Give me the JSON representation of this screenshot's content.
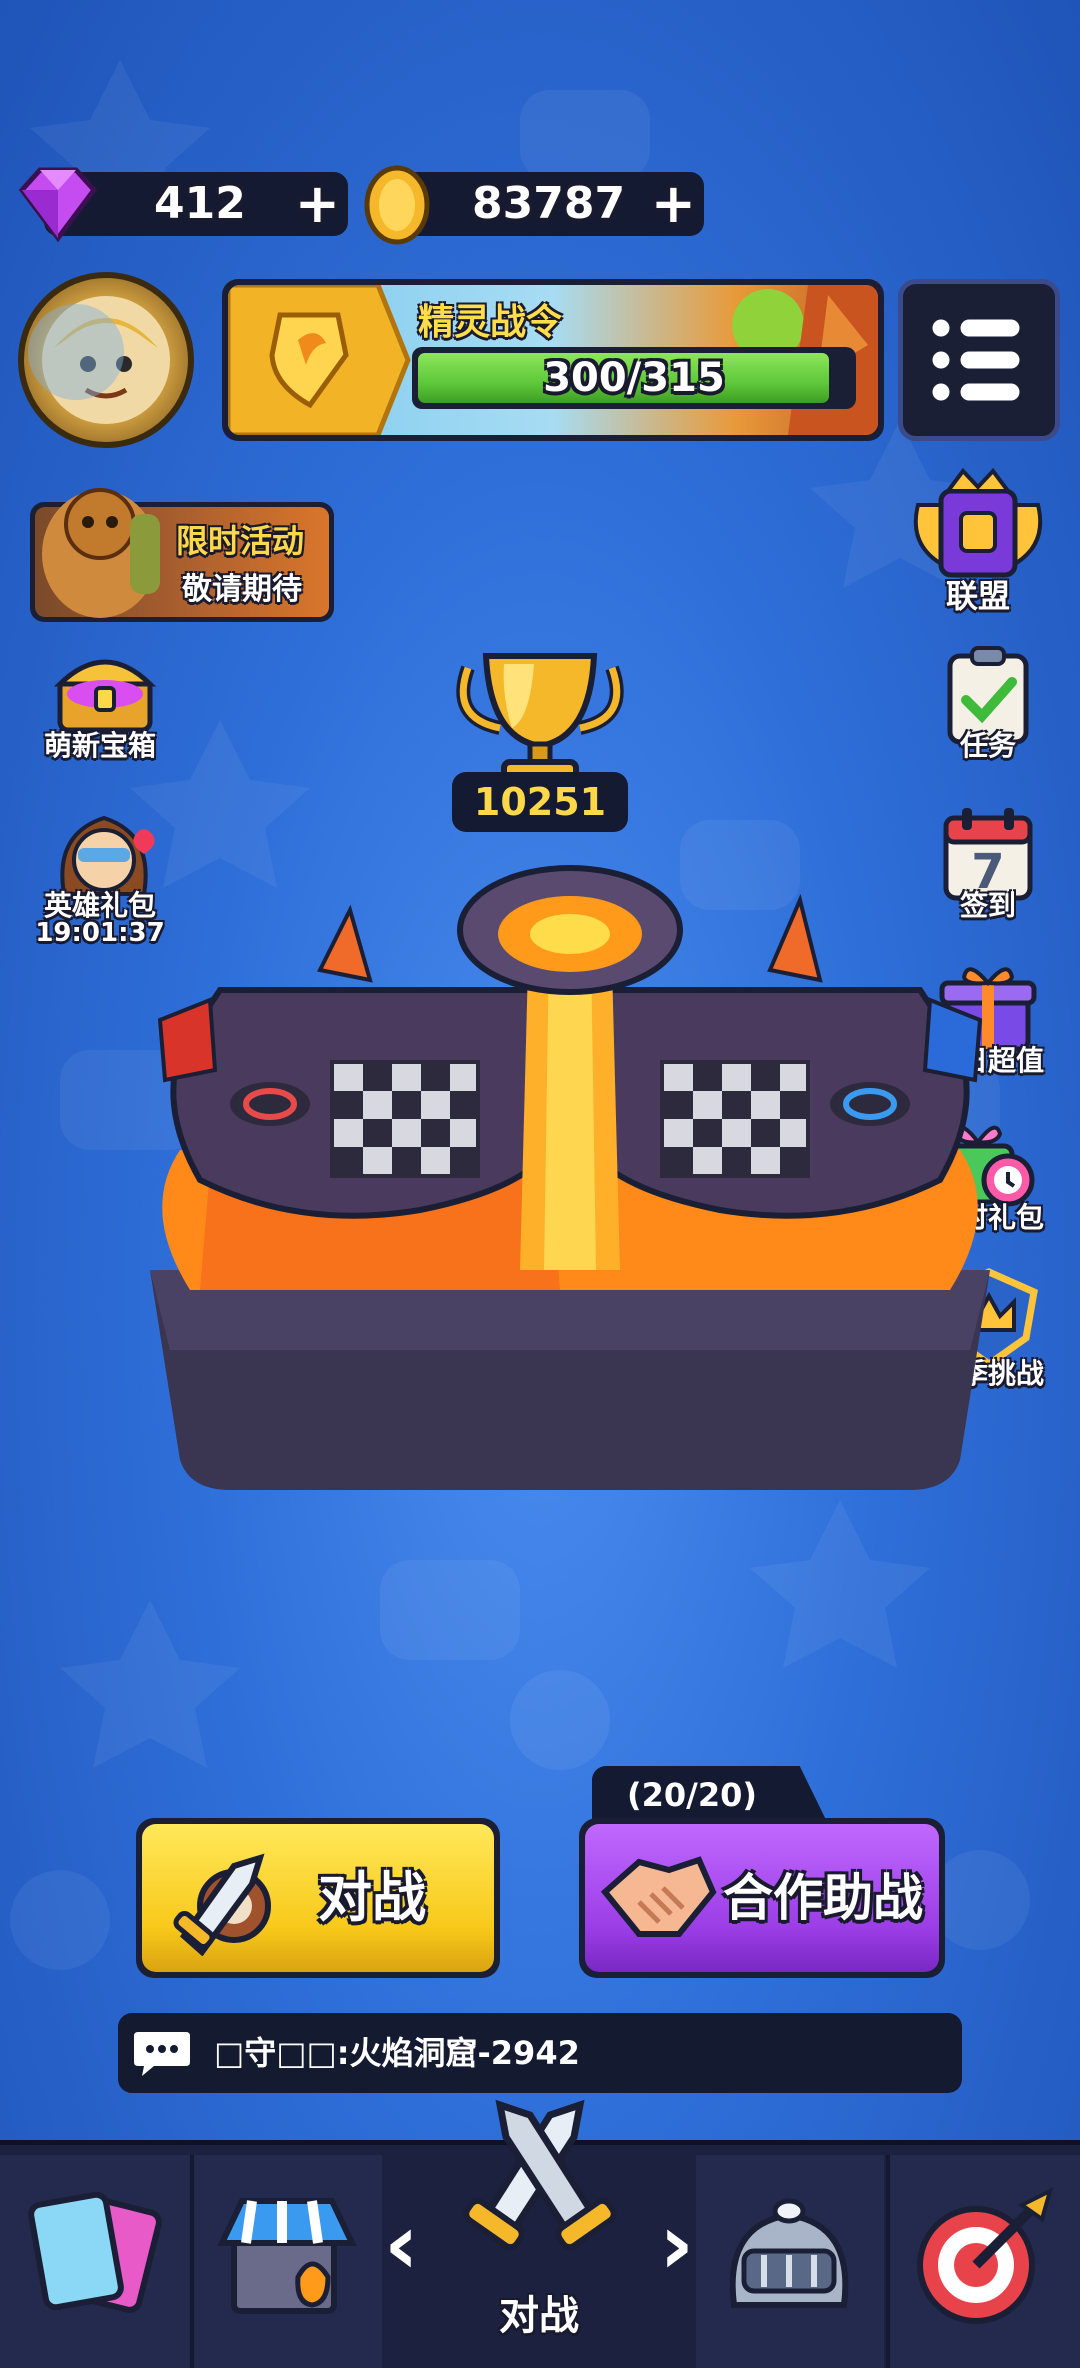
{
  "currency": {
    "gems": "412",
    "coins": "83787",
    "add_label": "+"
  },
  "battle_pass": {
    "title": "精灵战令",
    "progress_text": "300/315",
    "progress_fraction": 0.952
  },
  "left_side": {
    "event_line1": "限时活动",
    "event_line2": "敬请期待",
    "newbie_chest": "萌新宝箱",
    "hero_pack": "英雄礼包",
    "hero_pack_timer": "19:01:37"
  },
  "right_side": {
    "alliance": "联盟",
    "tasks": "任务",
    "checkin": "签到",
    "checkin_day": "7",
    "daily_deal": "每日超值",
    "limited_pack": "限时礼包",
    "season_challenge": "赛季挑战"
  },
  "trophies": "10251",
  "buttons": {
    "battle": "对战",
    "coop": "合作助战",
    "coop_count": "(20/20)"
  },
  "chat": {
    "message": "□守□□:火焰洞窟-2942"
  },
  "nav": {
    "active_label": "对战",
    "left_arrow": "‹",
    "right_arrow": "›"
  },
  "colors": {
    "background": "#2f6fd9",
    "battle_button": "#f8c91a",
    "coop_button": "#9b3ee6",
    "progress_green": "#5ec83a",
    "gem": "#c44cf0",
    "coin": "#f5b82a"
  }
}
